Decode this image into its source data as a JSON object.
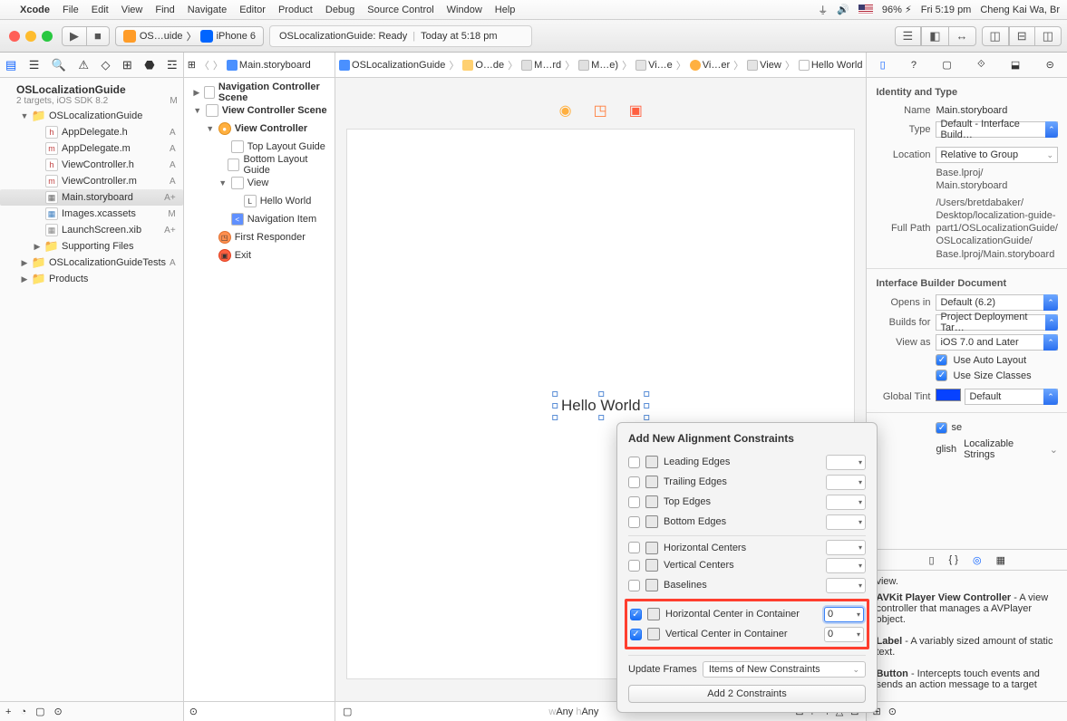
{
  "menubar": {
    "app": "Xcode",
    "items": [
      "File",
      "Edit",
      "View",
      "Find",
      "Navigate",
      "Editor",
      "Product",
      "Debug",
      "Source Control",
      "Window",
      "Help"
    ],
    "battery": "96%",
    "clock": "Fri 5:19 pm",
    "user": "Cheng Kai Wa, Br"
  },
  "toolbar": {
    "scheme_app": "OS…uide",
    "scheme_device": "iPhone 6",
    "status_primary": "OSLocalizationGuide: Ready",
    "status_secondary": "Today at 5:18 pm"
  },
  "navigator": {
    "project_title": "OSLocalizationGuide",
    "project_sub": "2 targets, iOS SDK 8.2",
    "project_status": "M",
    "tree": [
      {
        "depth": 1,
        "disc": "▼",
        "kind": "fold",
        "label": "OSLocalizationGuide",
        "status": ""
      },
      {
        "depth": 2,
        "disc": "",
        "kind": "h",
        "label": "AppDelegate.h",
        "status": "A"
      },
      {
        "depth": 2,
        "disc": "",
        "kind": "m",
        "label": "AppDelegate.m",
        "status": "A"
      },
      {
        "depth": 2,
        "disc": "",
        "kind": "h",
        "label": "ViewController.h",
        "status": "A"
      },
      {
        "depth": 2,
        "disc": "",
        "kind": "m",
        "label": "ViewController.m",
        "status": "A"
      },
      {
        "depth": 2,
        "disc": "",
        "kind": "sb",
        "label": "Main.storyboard",
        "status": "A+",
        "sel": true
      },
      {
        "depth": 2,
        "disc": "",
        "kind": "ass",
        "label": "Images.xcassets",
        "status": "M"
      },
      {
        "depth": 2,
        "disc": "",
        "kind": "xib",
        "label": "LaunchScreen.xib",
        "status": "A+"
      },
      {
        "depth": 2,
        "disc": "▶",
        "kind": "fold",
        "label": "Supporting Files",
        "status": ""
      },
      {
        "depth": 1,
        "disc": "▶",
        "kind": "fold",
        "label": "OSLocalizationGuideTests",
        "status": "A"
      },
      {
        "depth": 1,
        "disc": "▶",
        "kind": "fold",
        "label": "Products",
        "status": ""
      }
    ]
  },
  "outline": {
    "jump_bar_tail": "Main.storyboard",
    "rows": [
      {
        "depth": 0,
        "disc": "▶",
        "kind": "scene",
        "label": "Navigation Controller Scene"
      },
      {
        "depth": 0,
        "disc": "▼",
        "kind": "scene",
        "label": "View Controller Scene"
      },
      {
        "depth": 1,
        "disc": "▼",
        "kind": "vc",
        "label": "View Controller"
      },
      {
        "depth": 2,
        "disc": "",
        "kind": "guide",
        "label": "Top Layout Guide"
      },
      {
        "depth": 2,
        "disc": "",
        "kind": "guide",
        "label": "Bottom Layout Guide"
      },
      {
        "depth": 2,
        "disc": "▼",
        "kind": "view",
        "label": "View"
      },
      {
        "depth": 3,
        "disc": "",
        "kind": "label",
        "label": "Hello World"
      },
      {
        "depth": 2,
        "disc": "",
        "kind": "navitem",
        "label": "Navigation Item"
      },
      {
        "depth": 1,
        "disc": "",
        "kind": "fr",
        "label": "First Responder"
      },
      {
        "depth": 1,
        "disc": "",
        "kind": "ex",
        "label": "Exit"
      }
    ]
  },
  "canvas": {
    "jump": [
      "OSLocalizationGuide",
      "O…de",
      "M…rd",
      "M…e)",
      "Vi…e",
      "Vi…er",
      "View",
      "Hello World"
    ],
    "label_text": "Hello World",
    "size_class": "wAny hAny"
  },
  "popover": {
    "title": "Add New Alignment Constraints",
    "rows": [
      {
        "label": "Leading Edges",
        "checked": false,
        "value": ""
      },
      {
        "label": "Trailing Edges",
        "checked": false,
        "value": ""
      },
      {
        "label": "Top Edges",
        "checked": false,
        "value": ""
      },
      {
        "label": "Bottom Edges",
        "checked": false,
        "value": ""
      },
      {
        "label": "Horizontal Centers",
        "checked": false,
        "value": "",
        "sep": true
      },
      {
        "label": "Vertical Centers",
        "checked": false,
        "value": ""
      },
      {
        "label": "Baselines",
        "checked": false,
        "value": ""
      }
    ],
    "highlight": [
      {
        "label": "Horizontal Center in Container",
        "checked": true,
        "value": "0",
        "active": true
      },
      {
        "label": "Vertical Center in Container",
        "checked": true,
        "value": "0"
      }
    ],
    "update_frames_label": "Update Frames",
    "update_frames_value": "Items of New Constraints",
    "add_button": "Add 2 Constraints"
  },
  "inspector": {
    "identity": {
      "section": "Identity and Type",
      "name_label": "Name",
      "name": "Main.storyboard",
      "type_label": "Type",
      "type": "Default - Interface Build…",
      "location_label": "Location",
      "location": "Relative to Group",
      "location_path": "Base.lproj/\nMain.storyboard",
      "fullpath_label": "Full Path",
      "fullpath": "/Users/bretdabaker/\nDesktop/localization-guide-\npart1/OSLocalizationGuide/\nOSLocalizationGuide/\nBase.lproj/Main.storyboard"
    },
    "ibdoc": {
      "section": "Interface Builder Document",
      "opens_label": "Opens in",
      "opens": "Default (6.2)",
      "builds_label": "Builds for",
      "builds": "Project Deployment Tar…",
      "viewas_label": "View as",
      "viewas": "iOS 7.0 and Later",
      "auto_layout": "Use Auto Layout",
      "size_classes": "Use Size Classes",
      "tint_label": "Global Tint",
      "tint": "Default"
    },
    "loc": {
      "lang_partial": "se",
      "lang_full": "glish",
      "strings": "Localizable Strings"
    },
    "lib_top": "view.",
    "library": [
      {
        "title": "AVKit Player View Controller",
        "body": " - A view controller that manages a AVPlayer object."
      },
      {
        "title": "Label",
        "body": " - A variably sized amount of static text."
      },
      {
        "title": "Button",
        "body": " - Intercepts touch events and sends an action message to a target"
      }
    ]
  }
}
